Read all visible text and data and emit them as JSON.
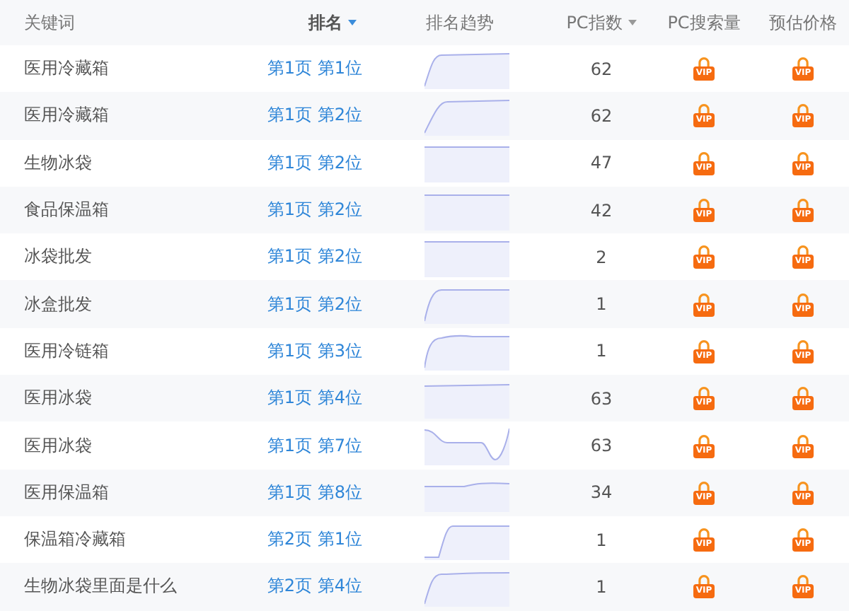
{
  "columns": [
    {
      "label": "关键词",
      "kind": "keyword"
    },
    {
      "label": "排名",
      "kind": "rank",
      "sortable": true,
      "sorted": true
    },
    {
      "label": "排名趋势",
      "kind": "trend"
    },
    {
      "label": "PC指数",
      "kind": "index",
      "sortable": true,
      "sorted": false
    },
    {
      "label": "PC搜索量",
      "kind": "locked"
    },
    {
      "label": "预估价格",
      "kind": "locked"
    }
  ],
  "rows": [
    {
      "keyword": "医用冷藏箱",
      "rank": "第1页 第1位",
      "pc_index": "62",
      "pc_volume": "VIP",
      "price": "VIP"
    },
    {
      "keyword": "医用冷藏箱",
      "rank": "第1页 第2位",
      "pc_index": "62",
      "pc_volume": "VIP",
      "price": "VIP"
    },
    {
      "keyword": "生物冰袋",
      "rank": "第1页 第2位",
      "pc_index": "47",
      "pc_volume": "VIP",
      "price": "VIP"
    },
    {
      "keyword": "食品保温箱",
      "rank": "第1页 第2位",
      "pc_index": "42",
      "pc_volume": "VIP",
      "price": "VIP"
    },
    {
      "keyword": "冰袋批发",
      "rank": "第1页 第2位",
      "pc_index": "2",
      "pc_volume": "VIP",
      "price": "VIP"
    },
    {
      "keyword": "冰盒批发",
      "rank": "第1页 第2位",
      "pc_index": "1",
      "pc_volume": "VIP",
      "price": "VIP"
    },
    {
      "keyword": "医用冷链箱",
      "rank": "第1页 第3位",
      "pc_index": "1",
      "pc_volume": "VIP",
      "price": "VIP"
    },
    {
      "keyword": "医用冰袋",
      "rank": "第1页 第4位",
      "pc_index": "63",
      "pc_volume": "VIP",
      "price": "VIP"
    },
    {
      "keyword": "医用冰袋",
      "rank": "第1页 第7位",
      "pc_index": "63",
      "pc_volume": "VIP",
      "price": "VIP"
    },
    {
      "keyword": "医用保温箱",
      "rank": "第1页 第8位",
      "pc_index": "34",
      "pc_volume": "VIP",
      "price": "VIP"
    },
    {
      "keyword": "保温箱冷藏箱",
      "rank": "第2页 第1位",
      "pc_index": "1",
      "pc_volume": "VIP",
      "price": "VIP"
    },
    {
      "keyword": "生物冰袋里面是什么",
      "rank": "第2页 第4位",
      "pc_index": "1",
      "pc_volume": "VIP",
      "price": "VIP"
    }
  ]
}
